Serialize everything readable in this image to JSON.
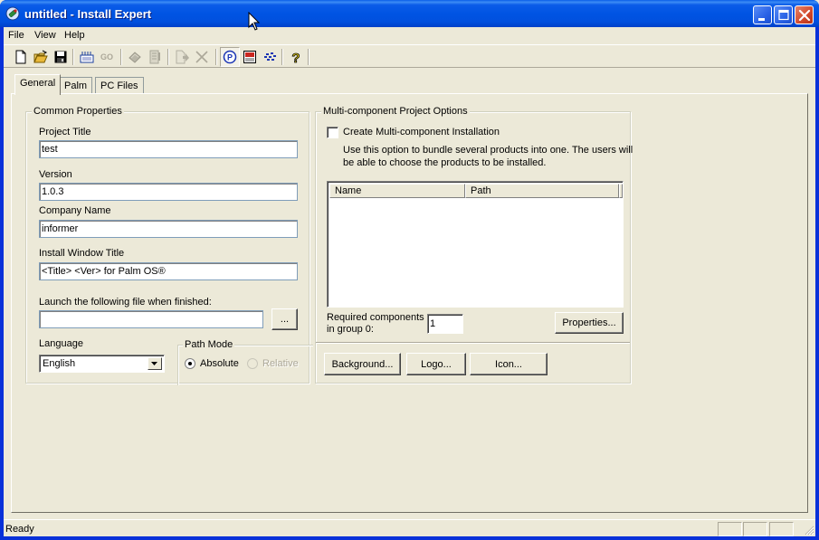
{
  "window": {
    "title": "untitled - Install Expert",
    "controls": [
      "minimize",
      "maximize",
      "close"
    ]
  },
  "menubar": {
    "items": [
      "File",
      "View",
      "Help"
    ]
  },
  "toolbar": {
    "buttons": [
      {
        "icon": "new-file-icon",
        "enabled": true
      },
      {
        "icon": "open-folder-icon",
        "enabled": true
      },
      {
        "icon": "save-icon",
        "enabled": true
      },
      {
        "icon": "build-icon",
        "enabled": true
      },
      {
        "icon": "go-icon",
        "label": "GO",
        "enabled": false
      },
      {
        "icon": "package-icon",
        "enabled": false
      },
      {
        "icon": "document-list-icon",
        "enabled": false
      },
      {
        "icon": "add-file-icon",
        "enabled": false
      },
      {
        "icon": "delete-icon",
        "enabled": false
      },
      {
        "icon": "palm-icon",
        "label": "P",
        "enabled": true,
        "pressed": true
      },
      {
        "icon": "windows-mobile-icon",
        "label": "WM",
        "enabled": true
      },
      {
        "icon": "blackberry-icon",
        "enabled": true
      },
      {
        "icon": "help-icon",
        "label": "?",
        "enabled": true
      }
    ]
  },
  "tabs": [
    {
      "label": "General",
      "active": true
    },
    {
      "label": "Palm",
      "active": false
    },
    {
      "label": "PC Files",
      "active": false
    }
  ],
  "common_properties": {
    "legend": "Common Properties",
    "project_title_label": "Project Title",
    "project_title_value": "test",
    "version_label": "Version",
    "version_value": "1.0.3",
    "company_label": "Company Name",
    "company_value": "informer",
    "install_window_title_label": "Install Window Title",
    "install_window_title_value": "<Title> <Ver> for Palm OS®",
    "launch_label": "Launch the following file when finished:",
    "launch_value": "",
    "browse_label": "...",
    "language_label": "Language",
    "language_value": "English",
    "path_mode": {
      "legend": "Path Mode",
      "options": [
        {
          "label": "Absolute",
          "checked": true,
          "enabled": true
        },
        {
          "label": "Relative",
          "checked": false,
          "enabled": false
        }
      ]
    }
  },
  "multi_component": {
    "legend": "Multi-component Project Options",
    "checkbox_label": "Create Multi-component Installation",
    "checkbox_checked": false,
    "description": "Use this option to bundle several products into one. The users will be able to choose the products to be installed.",
    "description_line1": "Use this option to bundle several products into one. The users will",
    "description_line2": "be able to choose the products to be installed.",
    "list_columns": [
      "Name",
      "Path"
    ],
    "list_rows": [],
    "required_label_line1": "Required components",
    "required_label_line2": "in group 0:",
    "required_value": "1",
    "properties_button": "Properties...",
    "background_button": "Background...",
    "logo_button": "Logo...",
    "icon_button": "Icon..."
  },
  "statusbar": {
    "text": "Ready"
  },
  "colors": {
    "titlebar": "#0054e3",
    "face": "#ece9d8",
    "close": "#d2482a"
  }
}
